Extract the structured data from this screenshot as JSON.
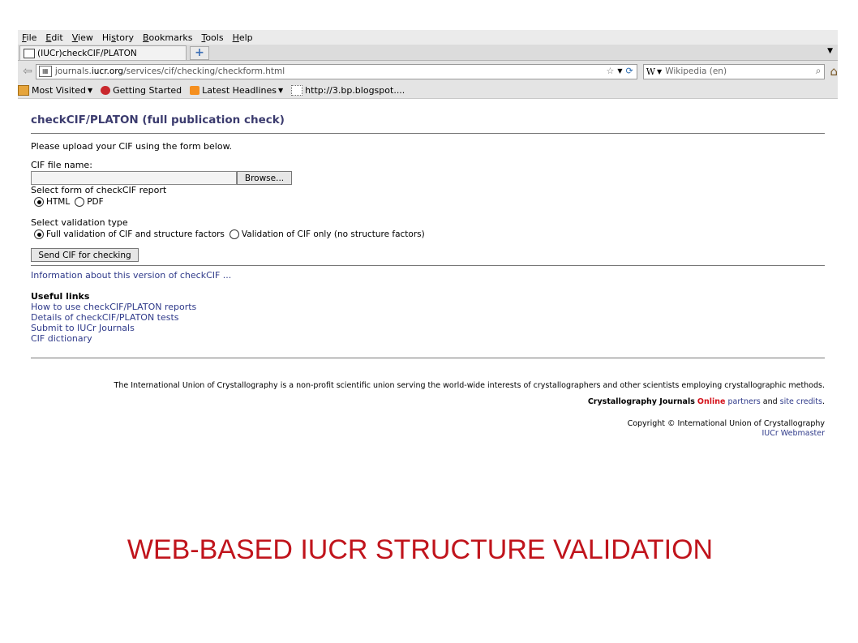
{
  "menu": [
    {
      "key": "F",
      "rest": "ile"
    },
    {
      "key": "E",
      "rest": "dit"
    },
    {
      "key": "V",
      "rest": "iew"
    },
    {
      "pre": "Hi",
      "key": "s",
      "rest": "tory"
    },
    {
      "key": "B",
      "rest": "ookmarks"
    },
    {
      "key": "T",
      "rest": "ools"
    },
    {
      "key": "H",
      "rest": "elp"
    }
  ],
  "tab": {
    "title": "(IUCr)checkCIF/PLATON",
    "new_tab": "+"
  },
  "address": {
    "domain_pre": "journals.",
    "domain": "iucr.org",
    "path": "/services/cif/checking/checkform.html"
  },
  "search": {
    "engine": "W",
    "placeholder": "Wikipedia (en)"
  },
  "bookmarks": [
    {
      "label": "Most Visited",
      "icon": "folder-icon",
      "dropdown": true
    },
    {
      "label": "Getting Started",
      "icon": "getting-started-icon",
      "dropdown": false
    },
    {
      "label": "Latest Headlines",
      "icon": "rss-icon",
      "dropdown": true
    },
    {
      "label": "http://3.bp.blogspot....",
      "icon": "page-icon",
      "dropdown": false
    }
  ],
  "page": {
    "title": "checkCIF/PLATON (full publication check)",
    "intro": "Please upload your CIF using the form below.",
    "file_label": "CIF file name:",
    "browse_label": "Browse...",
    "report_label": "Select form of checkCIF report",
    "report_options": [
      {
        "label": "HTML",
        "selected": true
      },
      {
        "label": "PDF",
        "selected": false
      }
    ],
    "validation_label": "Select validation type",
    "validation_options": [
      {
        "label": "Full validation of CIF and structure factors",
        "selected": true
      },
      {
        "label": "Validation of CIF only (no structure factors)",
        "selected": false
      }
    ],
    "send_label": "Send CIF for checking",
    "info_link": "Information about this version of checkCIF ...",
    "useful_heading": "Useful links",
    "useful_links": [
      "How to use checkCIF/PLATON reports",
      "Details of checkCIF/PLATON tests",
      "Submit to IUCr Journals",
      "CIF dictionary"
    ]
  },
  "footer": {
    "statement": "The International Union of Crystallography is a non-profit scientific union serving the world-wide interests of crystallographers and other scientists employing crystallographic methods.",
    "journals": "Crystallography Journals",
    "online": "Online",
    "partners": "partners",
    "and": "and",
    "site_credits": "site credits",
    "period": ".",
    "copyright": "Copyright © International Union of Crystallography",
    "webmaster": "IUCr Webmaster"
  },
  "slide_title": "WEB-BASED IUCR STRUCTURE VALIDATION",
  "colors": {
    "heading": "#3b3b6e",
    "link": "#2f3a8a",
    "online": "#d4121b",
    "slide_title": "#c0141c"
  }
}
